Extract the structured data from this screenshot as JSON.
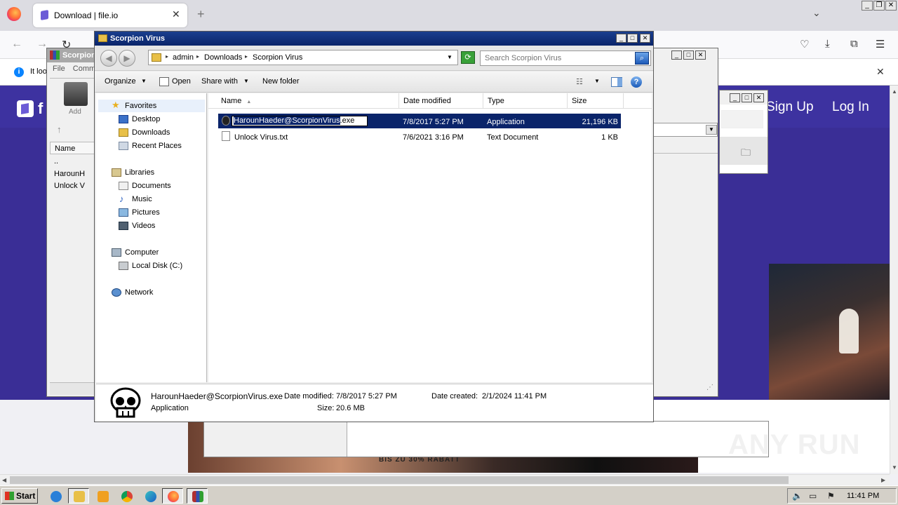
{
  "browser": {
    "tab_title": "Download | file.io",
    "notification_text": "It loo",
    "page_logo_text": "f",
    "signup": "Sign Up",
    "login": "Log In",
    "promo": "BIS ZU 30% RABATT"
  },
  "bg_window1": {
    "title": "Scorpion",
    "menu_file": "File",
    "menu_comm": "Comm",
    "add_label": "Add",
    "col_name": "Name",
    "rows": [
      "..",
      "HarounH",
      "Unlock V"
    ]
  },
  "explorer": {
    "title": "Scorpion Virus",
    "breadcrumb": [
      "admin",
      "Downloads",
      "Scorpion Virus"
    ],
    "search_placeholder": "Search Scorpion Virus",
    "toolbar": {
      "organize": "Organize",
      "open": "Open",
      "share_with": "Share with",
      "new_folder": "New folder"
    },
    "nav": {
      "favorites": "Favorites",
      "desktop": "Desktop",
      "downloads": "Downloads",
      "recent_places": "Recent Places",
      "libraries": "Libraries",
      "documents": "Documents",
      "music": "Music",
      "pictures": "Pictures",
      "videos": "Videos",
      "computer": "Computer",
      "local_disk": "Local Disk (C:)",
      "network": "Network"
    },
    "columns": {
      "name": "Name",
      "date_modified": "Date modified",
      "type": "Type",
      "size": "Size"
    },
    "files": [
      {
        "name_selected": "HarounHaeder@ScorpionVirus",
        "name_rest": ".exe",
        "date": "7/8/2017 5:27 PM",
        "type": "Application",
        "size": "21,196 KB"
      },
      {
        "name": "Unlock Virus.txt",
        "date": "7/6/2021 3:16 PM",
        "type": "Text Document",
        "size": "1 KB"
      }
    ],
    "details": {
      "filename": "HarounHaeder@ScorpionVirus.exe",
      "type": "Application",
      "date_modified_label": "Date modified:",
      "date_modified": "7/8/2017 5:27 PM",
      "size_label": "Size:",
      "size": "20.6 MB",
      "date_created_label": "Date created:",
      "date_created": "2/1/2024 11:41 PM"
    }
  },
  "taskbar": {
    "start": "Start",
    "clock": "11:41 PM"
  },
  "watermark": "ANY RUN"
}
